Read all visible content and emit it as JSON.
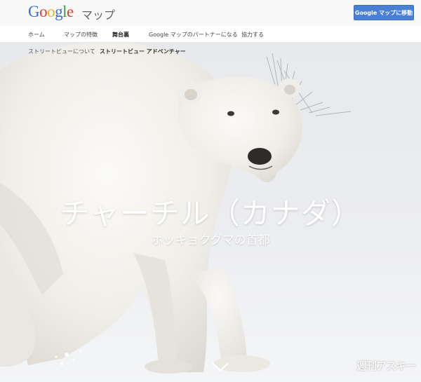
{
  "header": {
    "logo": {
      "g1": "G",
      "o1": "o",
      "o2": "o",
      "g2": "g",
      "l": "l",
      "e": "e"
    },
    "product": "マップ",
    "cta_label": "Google マップに移動"
  },
  "nav": {
    "items": [
      {
        "label": "ホーム"
      },
      {
        "label": "マップの特徴"
      },
      {
        "label": "舞台裏",
        "active": true
      },
      {
        "label": "Google マップのパートナーになる"
      },
      {
        "label": "協力する"
      }
    ]
  },
  "subnav": {
    "items": [
      {
        "label": "ストリートビューについて"
      },
      {
        "label": "ストリートビュー アドベンチャー",
        "active": true
      }
    ]
  },
  "hero": {
    "title": "チャーチル（カナダ）",
    "subtitle": "ホッキョクグマの首都",
    "scroll_icon": "chevron-down-icon"
  },
  "watermark": "週刊アスキー",
  "colors": {
    "cta": "#4a7fd6",
    "snow": "#eef0f2",
    "bear": "#f3f1ec"
  }
}
